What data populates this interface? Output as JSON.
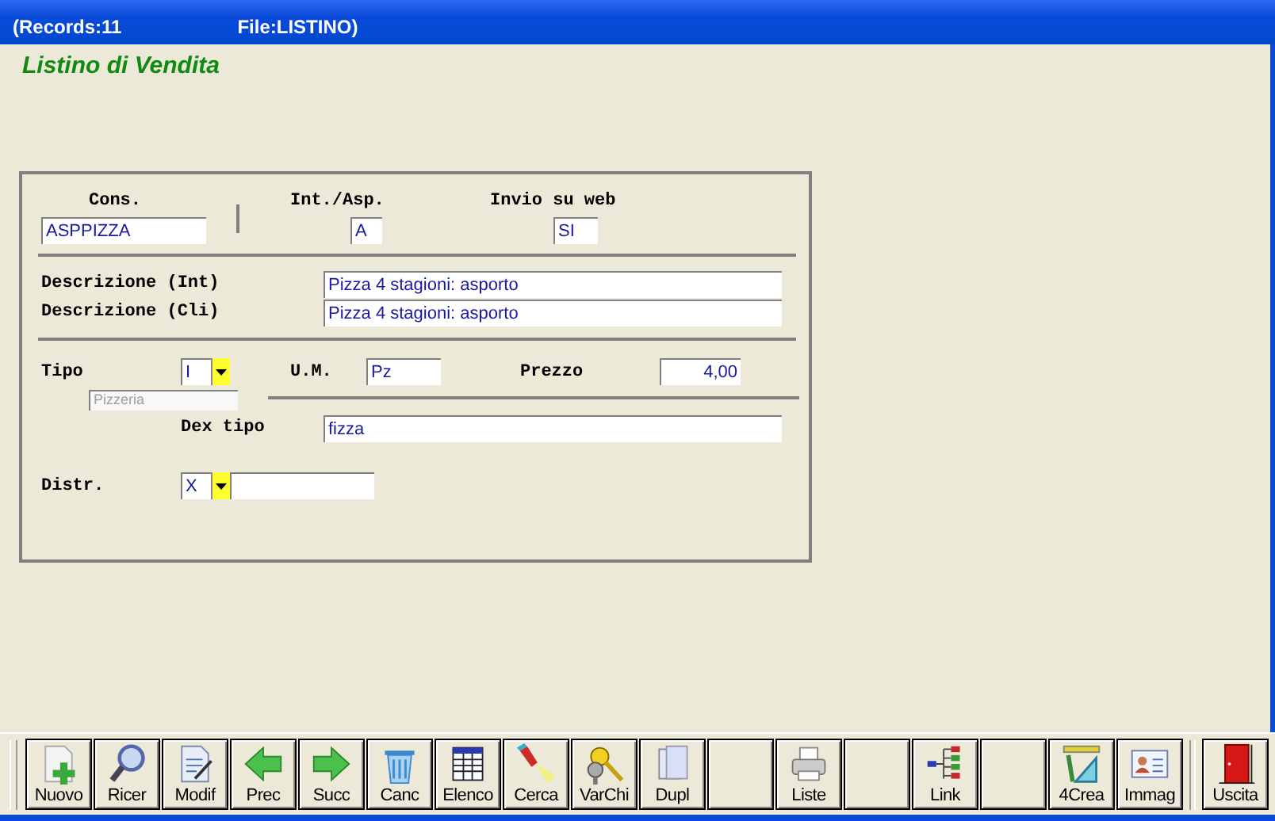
{
  "window": {
    "records": "(Records:11",
    "file": "File:LISTINO)"
  },
  "form_title": "Listino di Vendita",
  "cons": {
    "label": "Cons.",
    "value": "ASPPIZZA"
  },
  "int_asp": {
    "label": "Int./Asp.",
    "value": "A"
  },
  "invio_web": {
    "label": "Invio su web",
    "value": "SI"
  },
  "descr_int": {
    "label": "Descrizione (Int)",
    "value": "Pizza 4 stagioni: asporto"
  },
  "descr_cli": {
    "label": "Descrizione (Cli)",
    "value": "Pizza 4 stagioni: asporto"
  },
  "tipo": {
    "label": "Tipo",
    "value": "I"
  },
  "tipo_name": {
    "value": "Pizzeria",
    "disabled": true
  },
  "um": {
    "label": "U.M.",
    "value": "Pz"
  },
  "prezzo": {
    "label": "Prezzo",
    "value": "4,00"
  },
  "dex_tipo": {
    "label": "Dex tipo",
    "value": "fizza"
  },
  "distr": {
    "label": "Distr.",
    "value": "X"
  },
  "toolbar": [
    {
      "label": "Nuovo",
      "kind": "new"
    },
    {
      "label": "Ricer",
      "kind": "search"
    },
    {
      "label": "Modif",
      "kind": "edit"
    },
    {
      "label": "Prec",
      "kind": "prev"
    },
    {
      "label": "Succ",
      "kind": "next"
    },
    {
      "label": "Canc",
      "kind": "trash"
    },
    {
      "label": "Elenco",
      "kind": "table"
    },
    {
      "label": "Cerca",
      "kind": "torch"
    },
    {
      "label": "VarChi",
      "kind": "keys"
    },
    {
      "label": "Dupl",
      "kind": "copy"
    },
    {
      "kind": "blank"
    },
    {
      "label": "Liste",
      "kind": "print"
    },
    {
      "kind": "blank"
    },
    {
      "label": "Link",
      "kind": "link"
    },
    {
      "kind": "blank"
    },
    {
      "label": "4Crea",
      "kind": "ruler"
    },
    {
      "label": "Immag",
      "kind": "card"
    }
  ],
  "exit_button": {
    "label": "Uscita"
  }
}
